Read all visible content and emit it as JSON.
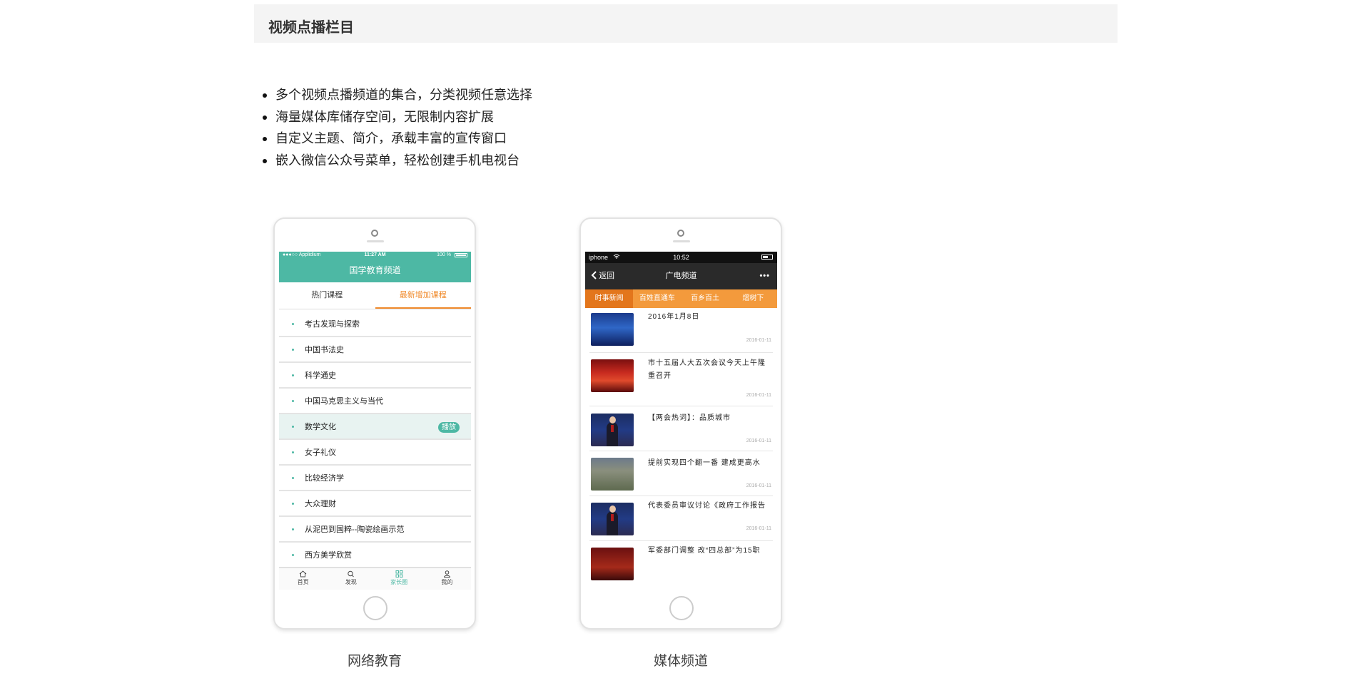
{
  "section": {
    "title": "视频点播栏目"
  },
  "features": [
    "多个视频点播频道的集合，分类视频任意选择",
    "海量媒体库储存空间，无限制内容扩展",
    "自定义主题、简介，承载丰富的宣传窗口",
    "嵌入微信公众号菜单，轻松创建手机电视台"
  ],
  "phone1": {
    "caption": "网络教育",
    "status": {
      "carrier": "●●●○○ Applidium",
      "time": "11:27 AM",
      "battery": "100 %"
    },
    "title": "国学教育频道",
    "tabs": [
      "热门课程",
      "最新增加课程"
    ],
    "active_tab": 1,
    "courses": [
      "考古发现与探索",
      "中国书法史",
      "科学通史",
      "中国马克思主义与当代",
      "数学文化",
      "女子礼仪",
      "比较经济学",
      "大众理财",
      "从泥巴到国粹--陶瓷绘画示范",
      "西方美学欣赏"
    ],
    "highlighted_course_badge": "播放",
    "nav": [
      "首页",
      "发现",
      "家长圈",
      "我的"
    ],
    "accent": "#4db8a4",
    "tab_accent": "#f08a2b"
  },
  "phone2": {
    "caption": "媒体频道",
    "status": {
      "carrier": "iphone",
      "time": "10:52"
    },
    "back_label": "返回",
    "title": "广电频道",
    "more": "•••",
    "categories": [
      "时事新闻",
      "百姓直通车",
      "百乡百土",
      "熠树下"
    ],
    "news": [
      {
        "title": "2016年1月8日",
        "date": "2016-01-11"
      },
      {
        "title": "市十五届人大五次会议今天上午隆重召开",
        "date": "2016-01-11"
      },
      {
        "title": "【两会热词】：品质城市",
        "date": "2016-01-11"
      },
      {
        "title": "提前实现四个翻一番 建成更高水",
        "date": "2016-01-11"
      },
      {
        "title": "代表委员审议讨论《政府工作报告",
        "date": "2016-01-11"
      },
      {
        "title": "军委部门调整 改“四总部”为15职",
        "date": ""
      }
    ],
    "accent": "#f39a3c"
  }
}
